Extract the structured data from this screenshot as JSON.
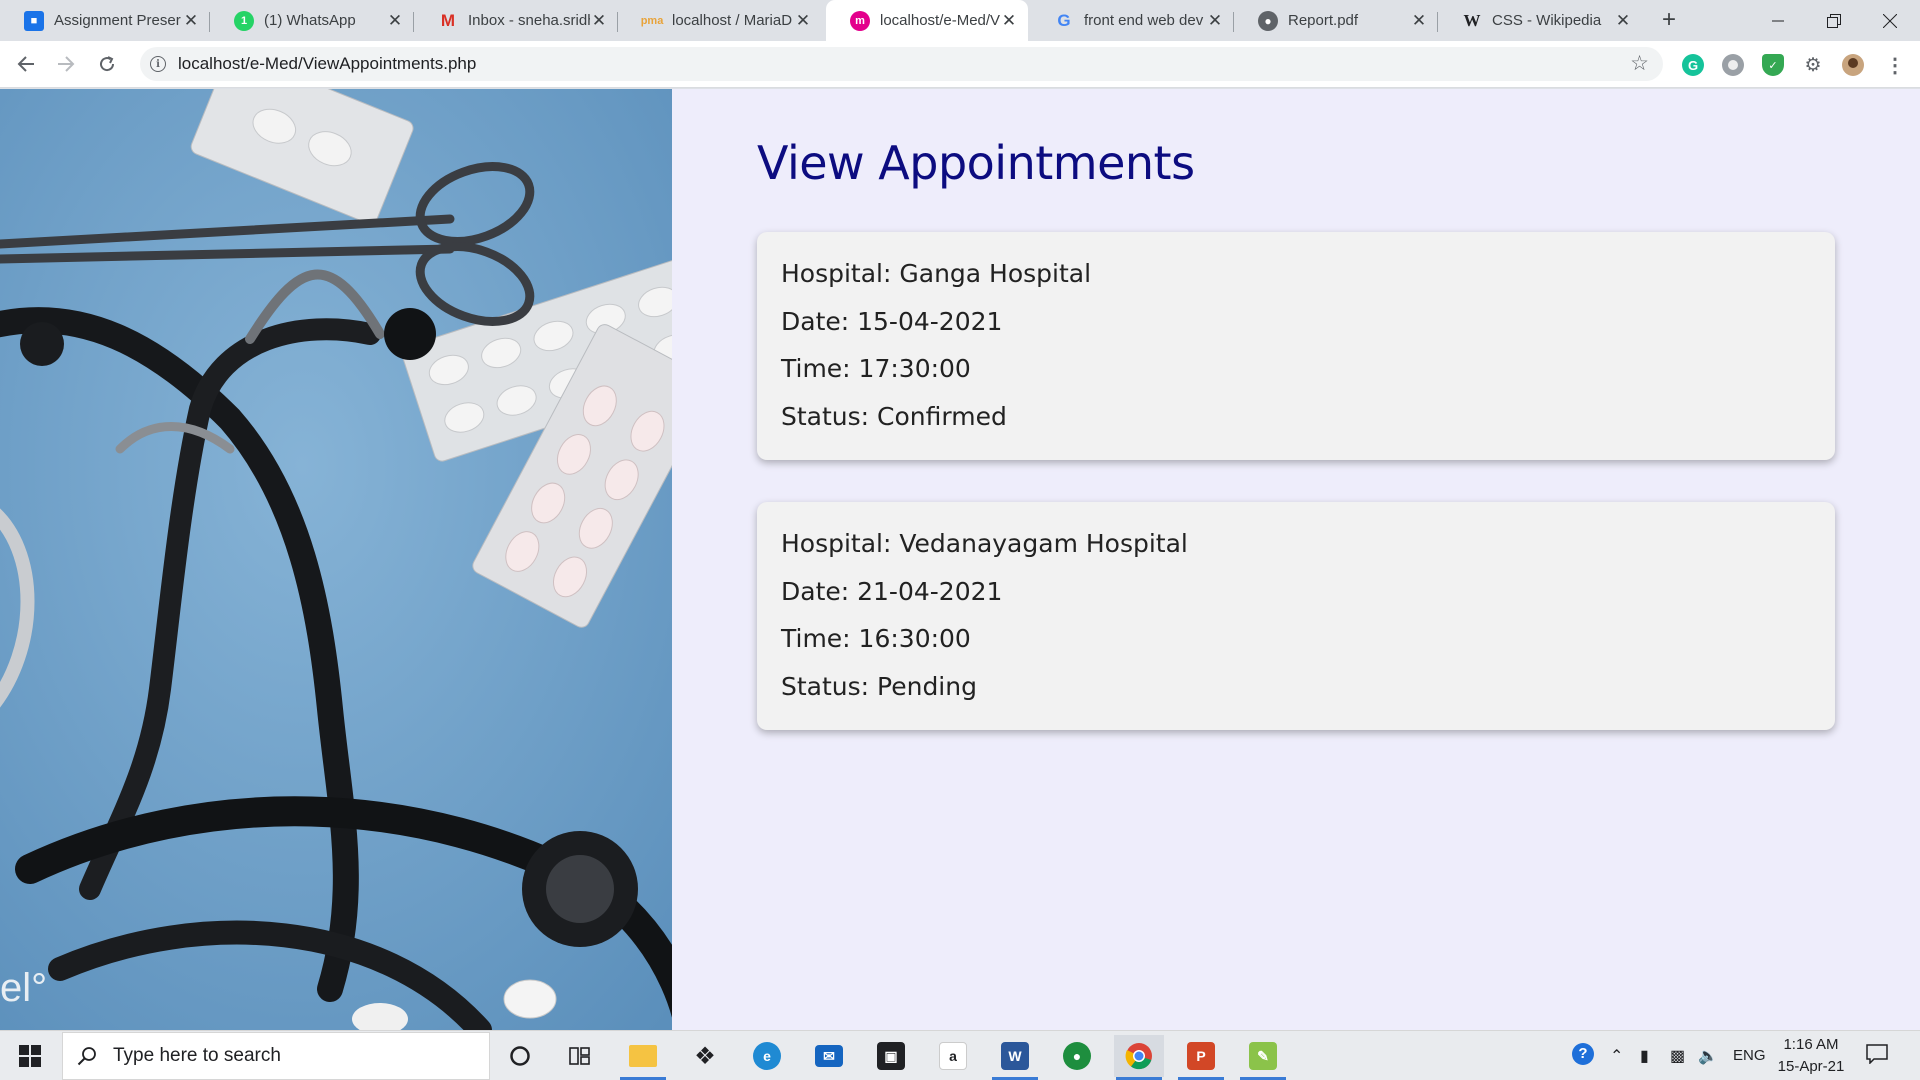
{
  "browser": {
    "tabs": [
      {
        "label": "Assignment Preser",
        "icon": "classroom-icon",
        "active": false
      },
      {
        "label": "(1) WhatsApp",
        "icon": "whatsapp-icon",
        "active": false
      },
      {
        "label": "Inbox - sneha.sridh",
        "icon": "gmail-icon",
        "active": false
      },
      {
        "label": "localhost / MariaD",
        "icon": "phpmyadmin-icon",
        "active": false
      },
      {
        "label": "localhost/e-Med/V",
        "icon": "emed-icon",
        "active": true
      },
      {
        "label": "front end web dev",
        "icon": "google-icon",
        "active": false
      },
      {
        "label": "Report.pdf",
        "icon": "globe-icon",
        "active": false
      },
      {
        "label": "CSS - Wikipedia",
        "icon": "wikipedia-icon",
        "active": false
      }
    ],
    "new_tab_label": "+",
    "address": "localhost/e-Med/ViewAppointments.php"
  },
  "page": {
    "title": "View Appointments",
    "appointments": [
      {
        "hospital": "Hospital: Ganga Hospital",
        "date": "Date: 15-04-2021",
        "time": "Time: 17:30:00",
        "status": "Status: Confirmed"
      },
      {
        "hospital": "Hospital: Vedanayagam Hospital",
        "date": "Date: 21-04-2021",
        "time": "Time: 16:30:00",
        "status": "Status: Pending"
      }
    ],
    "hero_watermark": "el°"
  },
  "taskbar": {
    "search_placeholder": "Type here to search",
    "language": "ENG",
    "time": "1:16 AM",
    "date": "15-Apr-21"
  },
  "colors": {
    "page_background": "#eeedfb",
    "title": "#0c0c80",
    "card_background": "#f2f2f2",
    "hero_background": "#6fa0c8"
  }
}
